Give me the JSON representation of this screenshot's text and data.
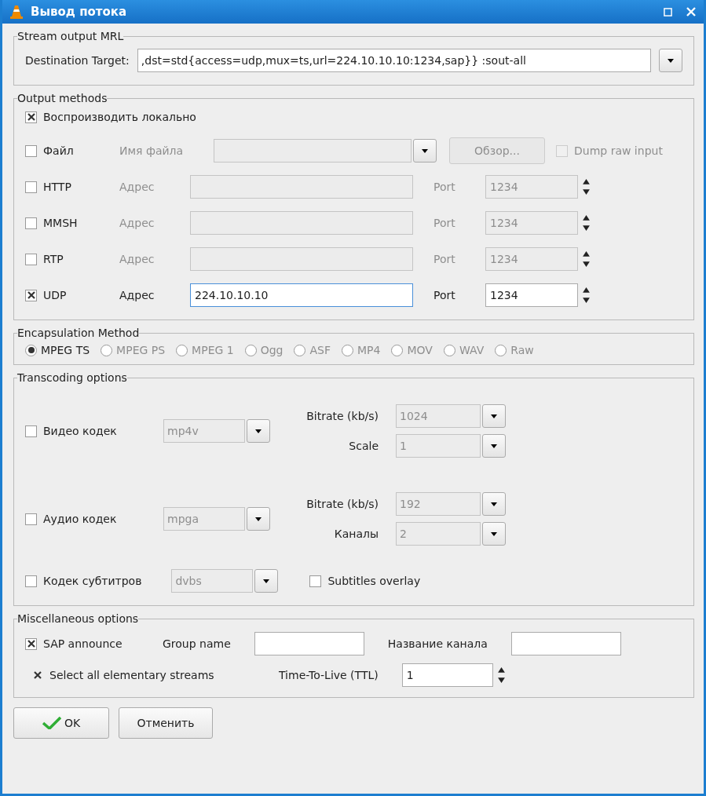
{
  "window": {
    "title": "Вывод потока"
  },
  "mrl": {
    "title": "Stream output MRL",
    "label": "Destination Target:",
    "value": ",dst=std{access=udp,mux=ts,url=224.10.10.10:1234,sap}} :sout-all"
  },
  "output_methods": {
    "title": "Output methods",
    "items": [
      {
        "kind": "local",
        "label": "Воспроизводить локально",
        "checked": true
      },
      {
        "kind": "file",
        "label": "Файл",
        "checked": false,
        "disabled": true,
        "field_label": "Имя файла",
        "browse": "Обзор...",
        "dump": {
          "label": "Dump raw input",
          "checked": false
        }
      },
      {
        "kind": "network",
        "label": "HTTP",
        "checked": false,
        "disabled": true,
        "field_label": "Адрес",
        "port_label": "Port",
        "port": "1234"
      },
      {
        "kind": "network",
        "label": "MMSH",
        "checked": false,
        "disabled": true,
        "field_label": "Адрес",
        "port_label": "Port",
        "port": "1234"
      },
      {
        "kind": "network",
        "label": "RTP",
        "checked": false,
        "disabled": true,
        "field_label": "Адрес",
        "port_label": "Port",
        "port": "1234"
      },
      {
        "kind": "network",
        "label": "UDP",
        "checked": true,
        "disabled": false,
        "field_label": "Адрес",
        "value": "224.10.10.10",
        "port_label": "Port",
        "port": "1234"
      }
    ]
  },
  "encapsulation": {
    "title": "Encapsulation Method",
    "options": [
      {
        "label": "MPEG TS",
        "selected": true,
        "disabled": false
      },
      {
        "label": "MPEG PS",
        "selected": false,
        "disabled": true
      },
      {
        "label": "MPEG 1",
        "selected": false,
        "disabled": true
      },
      {
        "label": "Ogg",
        "selected": false,
        "disabled": true
      },
      {
        "label": "ASF",
        "selected": false,
        "disabled": true
      },
      {
        "label": "MP4",
        "selected": false,
        "disabled": true
      },
      {
        "label": "MOV",
        "selected": false,
        "disabled": true
      },
      {
        "label": "WAV",
        "selected": false,
        "disabled": true
      },
      {
        "label": "Raw",
        "selected": false,
        "disabled": true
      }
    ]
  },
  "transcoding": {
    "title": "Transcoding options",
    "rows": [
      {
        "kind": "codec",
        "label": "Видео кодек",
        "checked": false,
        "codec": "mp4v",
        "params": [
          {
            "label": "Bitrate (kb/s)",
            "value": "1024"
          },
          {
            "label": "Scale",
            "value": "1"
          }
        ]
      },
      {
        "kind": "codec",
        "label": "Аудио кодек",
        "checked": false,
        "codec": "mpga",
        "params": [
          {
            "label": "Bitrate (kb/s)",
            "value": "192"
          },
          {
            "label": "Каналы",
            "value": "2"
          }
        ]
      },
      {
        "kind": "subtitles",
        "label": "Кодек субтитров",
        "checked": false,
        "codec": "dvbs",
        "overlay": {
          "label": "Subtitles overlay",
          "checked": false
        }
      }
    ]
  },
  "misc": {
    "title": "Miscellaneous options",
    "sap": {
      "label": "SAP announce",
      "checked": true
    },
    "group_label": "Group name",
    "channel_label": "Название канала",
    "select_all": {
      "label": "Select all elementary streams",
      "checked": true
    },
    "ttl_label": "Time-To-Live (TTL)",
    "ttl": "1"
  },
  "buttons": [
    {
      "kind": "ok",
      "label": "OK"
    },
    {
      "kind": "cancel",
      "label": "Отменить"
    }
  ]
}
